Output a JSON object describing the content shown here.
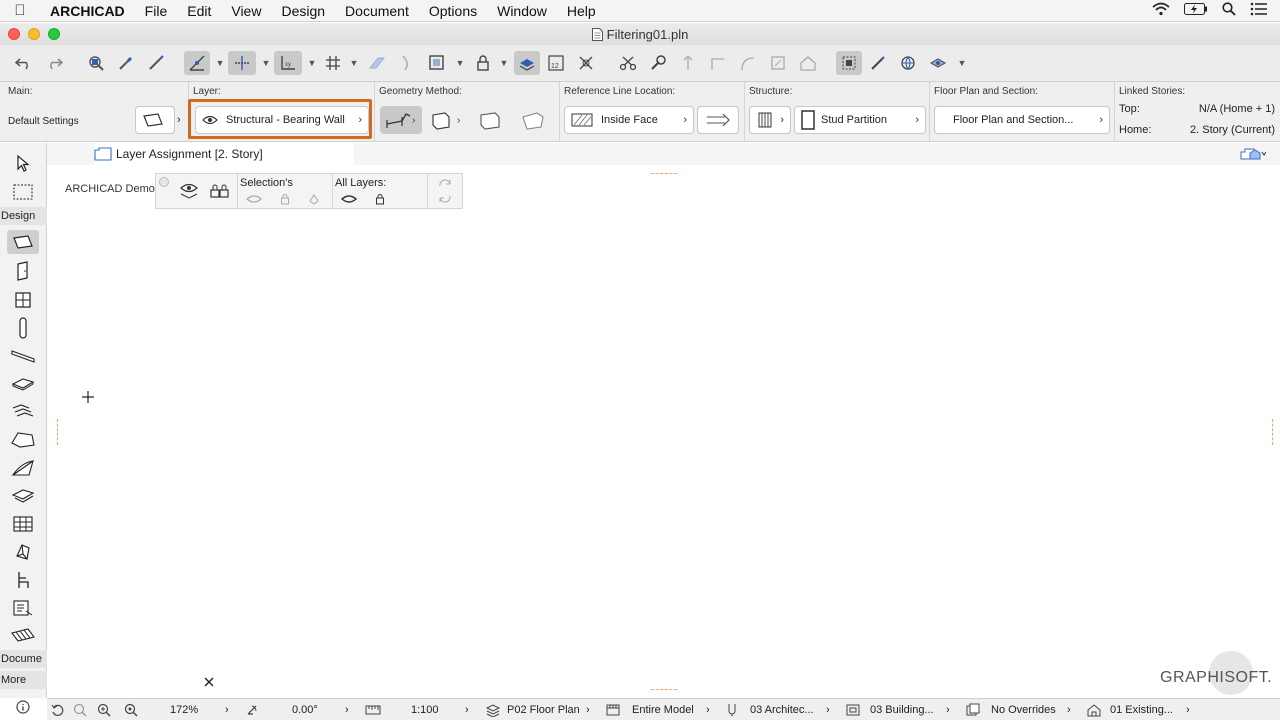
{
  "menubar": {
    "app": "ARCHICAD",
    "items": [
      "File",
      "Edit",
      "View",
      "Design",
      "Document",
      "Options",
      "Window",
      "Help"
    ]
  },
  "window": {
    "title": "Filtering01.pln"
  },
  "infobox": {
    "main_label": "Main:",
    "main_value": "Default Settings",
    "layer_label": "Layer:",
    "layer_value": "Structural - Bearing Wall",
    "geometry_label": "Geometry Method:",
    "refline_label": "Reference Line Location:",
    "refline_value": "Inside Face",
    "structure_label": "Structure:",
    "structure_value": "Stud Partition",
    "floorplan_label": "Floor Plan and Section:",
    "floorplan_value": "Floor Plan and Section...",
    "linked_label": "Linked Stories:",
    "top_label": "Top:",
    "top_value": "N/A (Home + 1)",
    "home_label": "Home:",
    "home_value": "2. Story (Current)"
  },
  "toolbox": {
    "design_label": "Design",
    "document_label": "Docume",
    "more_label": "More"
  },
  "tab": {
    "label": "Layer Assignment [2. Story]"
  },
  "quick_layers": {
    "owner_label": "ARCHICAD Demo",
    "selection_label": "Selection's",
    "all_layers_label": "All Layers:"
  },
  "statusbar": {
    "zoom": "172%",
    "angle": "0.00°",
    "scale": "1:100",
    "view": "P02 Floor Plan",
    "model": "Entire Model",
    "pen_set": "03 Architec...",
    "mvo": "03 Building...",
    "overrides": "No Overrides",
    "renovation": "01 Existing..."
  },
  "watermark": "GRAPHISOFT.",
  "colors": {
    "highlight": "#d2691e"
  }
}
